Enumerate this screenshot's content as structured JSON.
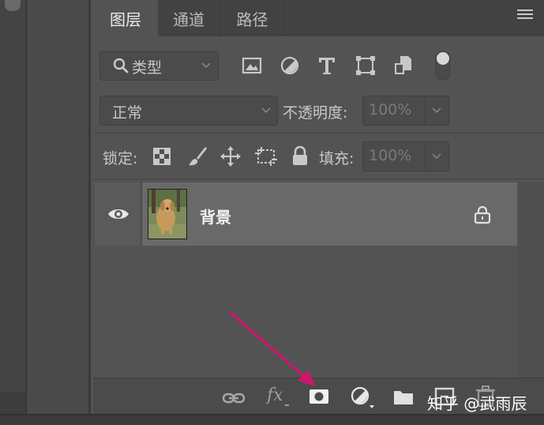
{
  "tabs": [
    {
      "label": "图层",
      "active": true
    },
    {
      "label": "通道",
      "active": false
    },
    {
      "label": "路径",
      "active": false
    }
  ],
  "filter": {
    "kind_label": "类型",
    "icons": [
      "image-filter-icon",
      "adjustment-filter-icon",
      "type-filter-icon",
      "shape-filter-icon",
      "smart-object-filter-icon",
      "filter-toggle-icon"
    ]
  },
  "blend": {
    "mode": "正常",
    "opacity_label": "不透明度:",
    "opacity_value": "100%"
  },
  "lock": {
    "label": "锁定:",
    "fill_label": "填充:",
    "fill_value": "100%"
  },
  "layers": [
    {
      "name": "背景",
      "visible": true,
      "locked": true
    }
  ],
  "footer": {
    "fx_label": "fx"
  },
  "watermark": "知乎 @武雨辰",
  "colors": {
    "panel_bg": "#535353",
    "selected_row": "#696969",
    "annotation_arrow": "#d0156e"
  }
}
